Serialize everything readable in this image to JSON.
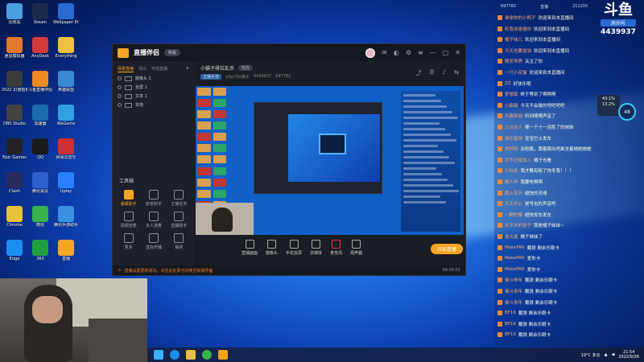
{
  "desktop": {
    "icons": [
      "回收站",
      "Steam",
      "Wallpaper Engine",
      "逍遥模拟器",
      "AnyDesk",
      "Everything",
      "2022 幻兽帕鲁",
      "斗鱼直播伴侣",
      "英雄联盟",
      "OBS Studio",
      "加速器",
      "WeGame",
      "Epic Games",
      "QQ",
      "网易云音乐",
      "Clash",
      "腾讯会议",
      "Uplay",
      "Chrome",
      "微信",
      "腾讯手游助手",
      "Edge",
      "360",
      "直播"
    ]
  },
  "app": {
    "title": "直播伴侣",
    "version": "新版",
    "left_tabs": [
      "场景直播",
      "观众",
      "可选直播"
    ],
    "scenes": [
      "摄像头 1",
      "全屏 1",
      "文本 1",
      "本地"
    ],
    "tools_title": "工具箱",
    "tools": [
      {
        "label": "弹幕助手",
        "hot": true
      },
      {
        "label": "房管助手",
        "hot": false
      },
      {
        "label": "主播任务",
        "hot": false
      },
      {
        "label": "视频连麦",
        "hot": false
      },
      {
        "label": "多人连麦",
        "hot": false
      },
      {
        "label": "直播助手",
        "hot": false
      },
      {
        "label": "更多",
        "hot": false
      },
      {
        "label": "虚拟开播",
        "hot": false
      },
      {
        "label": "抽奖",
        "hot": false
      }
    ],
    "stream_title": "小猫子排位乱杀",
    "stream_tag": "修改",
    "stream_meta": [
      "主播手游",
      "e5pr7hr橘子",
      "4439937",
      "697782"
    ],
    "controls": [
      "直播画面",
      "摄像头",
      "手机投屏",
      "多媒体",
      "麦克风",
      "扬声器"
    ],
    "start_label": "开启直播",
    "status_text": "直播设置更新成功，点击此处即可切换至新版界面",
    "status_time": "06:00:01"
  },
  "chat": {
    "top_left": "697782",
    "top_mid": "直播",
    "top_right": "211155",
    "room_logo": "斗鱼",
    "room_label": "房间号",
    "room_id": "4439937",
    "badge": "48",
    "notif": "43.1%\n13.2%",
    "messages": [
      {
        "user": "谢谢你的小鸭子",
        "text": "欢迎来到本直播间"
      },
      {
        "user": "听我说谢谢你",
        "text": "欢迎来到本直播间"
      },
      {
        "user": "橘子味儿",
        "text": "欢迎来到本直播间"
      },
      {
        "user": "今天也要加油",
        "text": "欢迎来到本直播间"
      },
      {
        "user": "晚安世界",
        "text": "关注了你"
      },
      {
        "user": "一只小花猫",
        "text": "欢迎来到本直播间"
      },
      {
        "user": "ZZ",
        "text": "好快乐哦"
      },
      {
        "user": "梦想家",
        "text": "终于等到了啊啊啊"
      },
      {
        "user": "小甜甜",
        "text": "今天不会输的吧吧吧吧"
      },
      {
        "user": "不服来战",
        "text": "听到嘀嘀声音了"
      },
      {
        "user": "上分达人",
        "text": "哪一个十一连胜了的妹妹"
      },
      {
        "user": "快乐星球",
        "text": "宝宝巴士发车"
      },
      {
        "user": "你好呀",
        "text": "双枪跳，跟着跳出吧乘坐着她她她她"
      },
      {
        "user": "打不过就加入",
        "text": "橘子也看"
      },
      {
        "user": "小仙女",
        "text": "我才舞有秘了快冬我！！！"
      },
      {
        "user": "路人甲",
        "text": "我要吃啊啊"
      },
      {
        "user": "陌上花开",
        "text": "超快的灵魂"
      },
      {
        "user": "天天开心",
        "text": "是号包的声音吧"
      },
      {
        "user": "一颗柠檬",
        "text": "超快发车发车"
      },
      {
        "user": "长不大的孩子",
        "text": "我是橘子妹妹~"
      },
      {
        "user": "追光者",
        "text": "橘子妹妹了"
      },
      {
        "user": "MakeFAR",
        "text": "戴铁 剩余乐眼卡"
      },
      {
        "user": "MakeFAR",
        "text": "爱你卡"
      },
      {
        "user": "MakeFAR",
        "text": "爱你卡"
      },
      {
        "user": "奋斗青年",
        "text": "戴铁 剩余乐眼卡"
      },
      {
        "user": "奋斗青年",
        "text": "戴铁 剩余乐眼卡"
      },
      {
        "user": "奋斗青年",
        "text": "戴铁 剩余乐眼卡"
      },
      {
        "user": "BF16",
        "text": "戴铁 剩余乐眼卡"
      },
      {
        "user": "BF16",
        "text": "戴铁 剩余乐眼卡"
      },
      {
        "user": "BF16",
        "text": "戴铁 剩余乐眼卡"
      }
    ]
  },
  "taskbar": {
    "weather": "19°C 多云",
    "time": "21:54",
    "date": "2022/9/26"
  },
  "colors": {
    "accent": "#f5a623",
    "desktop": "#1f6fe0",
    "chat_user": "#f9a86a"
  }
}
